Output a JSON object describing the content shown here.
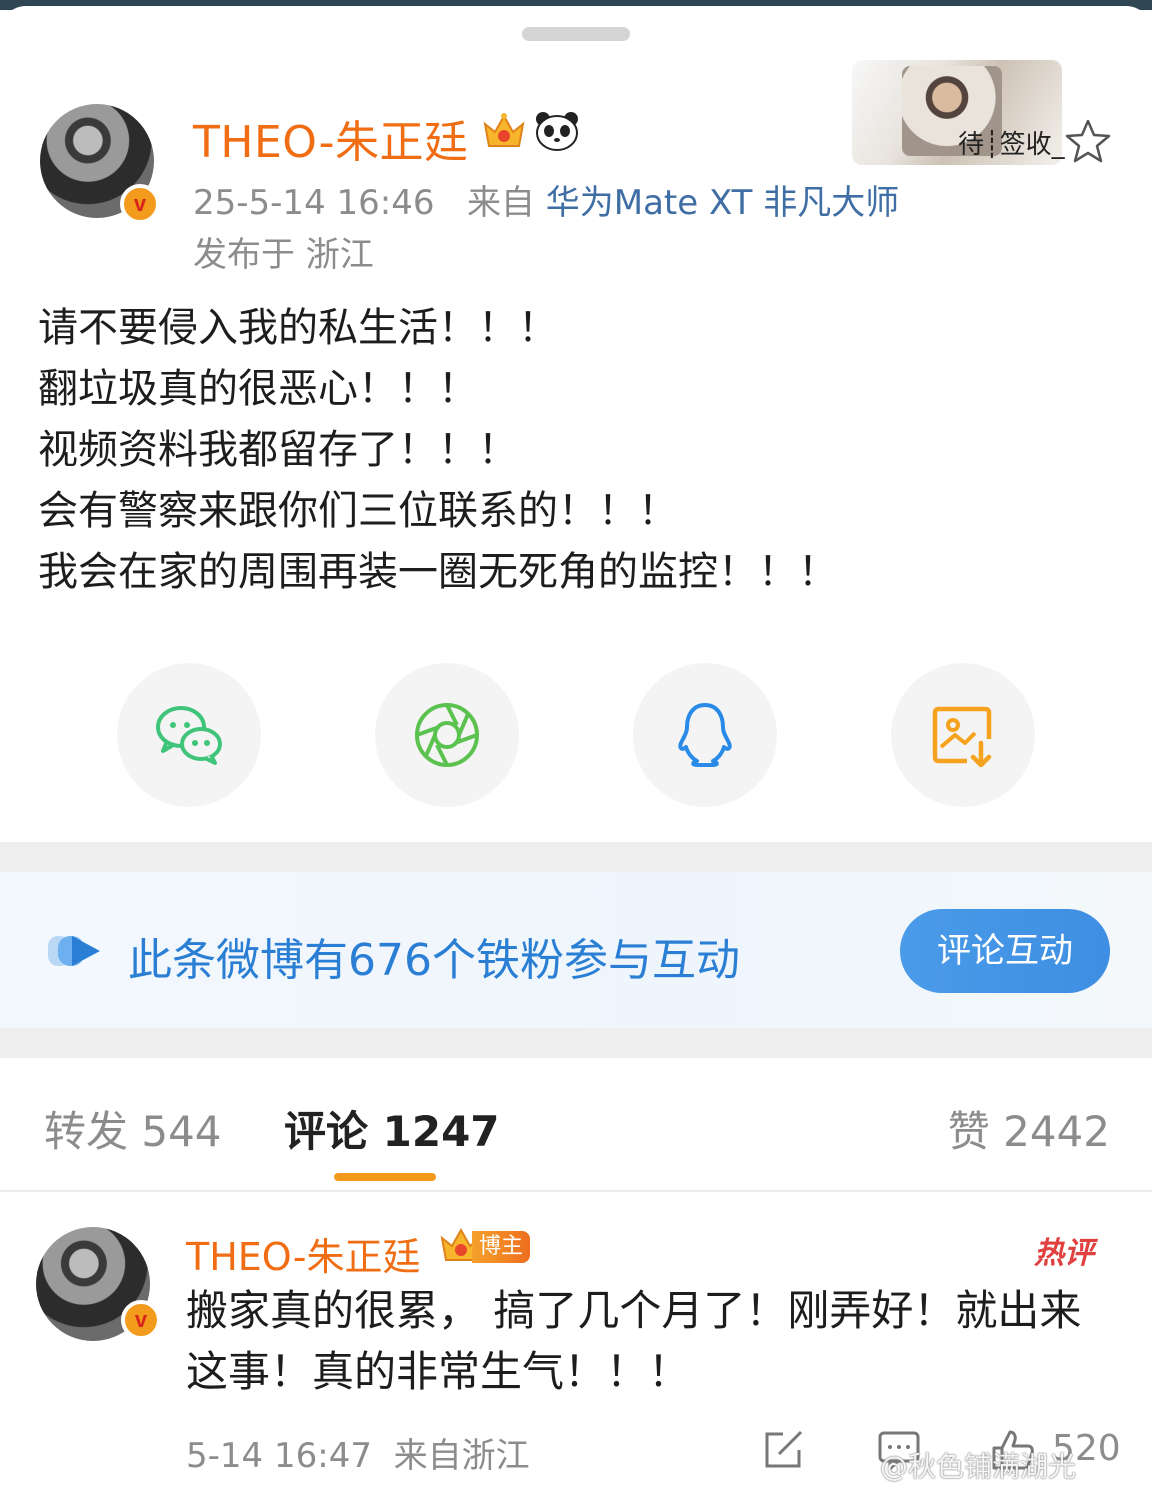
{
  "post": {
    "author": "THEO-朱正廷",
    "time": "25-5-14 16:46",
    "source_prefix": "来自",
    "device": "华为Mate XT 非凡大师",
    "location": "发布于 浙江",
    "badge_label": "待┊签收_",
    "body_lines": [
      "请不要侵入我的私生活！！！",
      "翻垃圾真的很恶心！！！",
      "视频资料我都留存了！！！",
      "会有警察来跟你们三位联系的！！！",
      "我会在家的周围再装一圈无死角的监控！！！"
    ]
  },
  "share": {
    "icons": [
      "wechat-icon",
      "moments-icon",
      "qq-icon",
      "save-image-icon"
    ],
    "colors": {
      "wechat": "#3fc47a",
      "moments": "#5cc24f",
      "qq": "#2a8ae8",
      "save": "#f5a31f"
    }
  },
  "fans_banner": {
    "text": "此条微博有676个铁粉参与互动",
    "button": "评论互动"
  },
  "tabs": {
    "repost": "转发 544",
    "comments": "评论 1247",
    "likes": "赞 2442"
  },
  "comment": {
    "author": "THEO-朱正廷",
    "host_badge": "博主",
    "hot_tag": "热评",
    "text": "搬家真的很累， 搞了几个月了！刚弄好！就出来这事！真的非常生气！！！",
    "time": "5-14 16:47",
    "location": "来自浙江",
    "like_count": "520"
  },
  "watermark": "@秋色铺满湖光",
  "colors": {
    "accent_orange": "#f06d14",
    "link_blue": "#3f6ea4",
    "banner_blue": "#2a7fd4",
    "tab_indicator": "#f39a1d"
  }
}
